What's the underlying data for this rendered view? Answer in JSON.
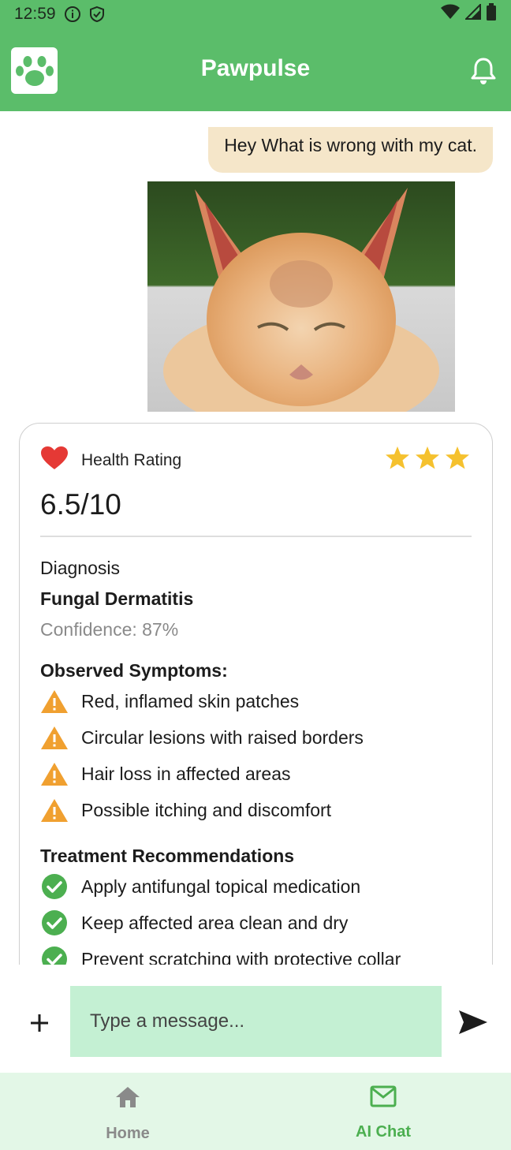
{
  "status_bar": {
    "time": "12:59",
    "icons": [
      "info-icon",
      "shield-icon",
      "wifi-icon",
      "signal-icon",
      "battery-icon"
    ]
  },
  "header": {
    "title": "Pawpulse",
    "logo_icon": "paw-icon",
    "notification_icon": "bell-icon"
  },
  "chat": {
    "user_message": "Hey What is wrong with my cat.",
    "photo_icon": "cat-photo"
  },
  "result": {
    "health_label": "Health Rating",
    "rating": "6.5/10",
    "stars_shown": 3,
    "diagnosis_label": "Diagnosis",
    "diagnosis": "Fungal Dermatitis",
    "confidence": "Confidence: 87%",
    "symptoms_title": "Observed Symptoms:",
    "symptoms": [
      "Red, inflamed skin patches",
      "Circular lesions with raised borders",
      "Hair loss in affected areas",
      "Possible itching and discomfort"
    ],
    "treatment_title": "Treatment Recommendations",
    "treatments": [
      "Apply antifungal topical medication",
      "Keep affected area clean and dry",
      "Prevent scratching with protective collar"
    ]
  },
  "composer": {
    "placeholder": "Type a message..."
  },
  "nav": {
    "items": [
      {
        "label": "Home",
        "icon": "home-icon",
        "active": false
      },
      {
        "label": "AI Chat",
        "icon": "mail-icon",
        "active": true
      }
    ]
  },
  "colors": {
    "primary": "#5bbd6a",
    "user_bubble": "#f5e6c9",
    "input_bg": "#c4f0d3",
    "nav_bg": "#e3f7e7",
    "warning": "#f0a030",
    "success": "#4caf50",
    "star": "#f5c12e",
    "heart": "#e53935",
    "nav_active": "#4caf50",
    "nav_inactive": "#8a8a8a"
  }
}
